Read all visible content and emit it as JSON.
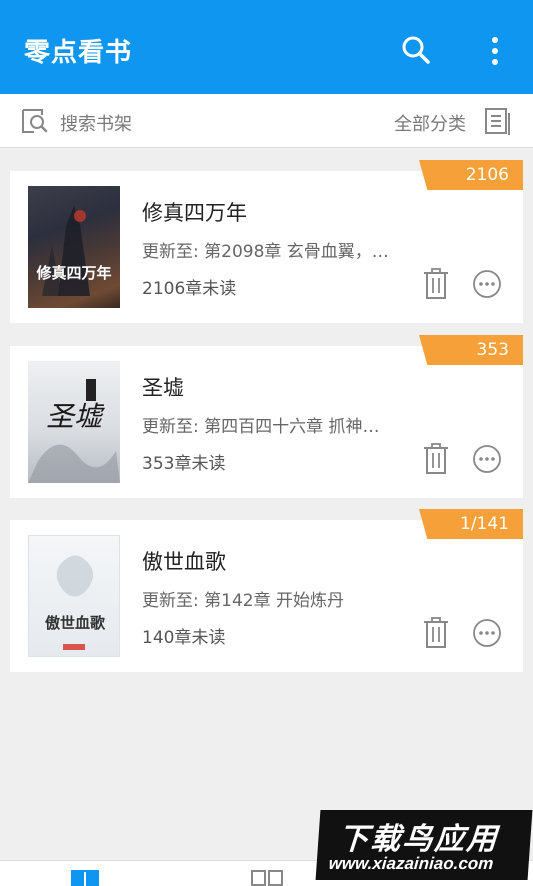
{
  "header": {
    "title": "零点看书",
    "search_icon": "search-icon",
    "more_icon": "more-vertical-icon",
    "color": "#0f96f0"
  },
  "search": {
    "label": "搜索书架",
    "category_label": "全部分类"
  },
  "books": [
    {
      "title": "修真四万年",
      "update": "更新至: 第2098章 玄骨血翼，…",
      "unread": "2106章未读",
      "badge": "2106",
      "cover_text": "修真四万年"
    },
    {
      "title": "圣墟",
      "update": "更新至: 第四百四十六章 抓神…",
      "unread": "353章未读",
      "badge": "353",
      "cover_text": "圣墟"
    },
    {
      "title": "傲世血歌",
      "update": "更新至: 第142章 开始炼丹",
      "unread": "140章未读",
      "badge": "1/141",
      "cover_text": "傲世血歌"
    }
  ],
  "badge_color": "#f6a039",
  "watermark": {
    "top": "下载鸟应用",
    "bottom": "www.xiazainiao.com"
  }
}
